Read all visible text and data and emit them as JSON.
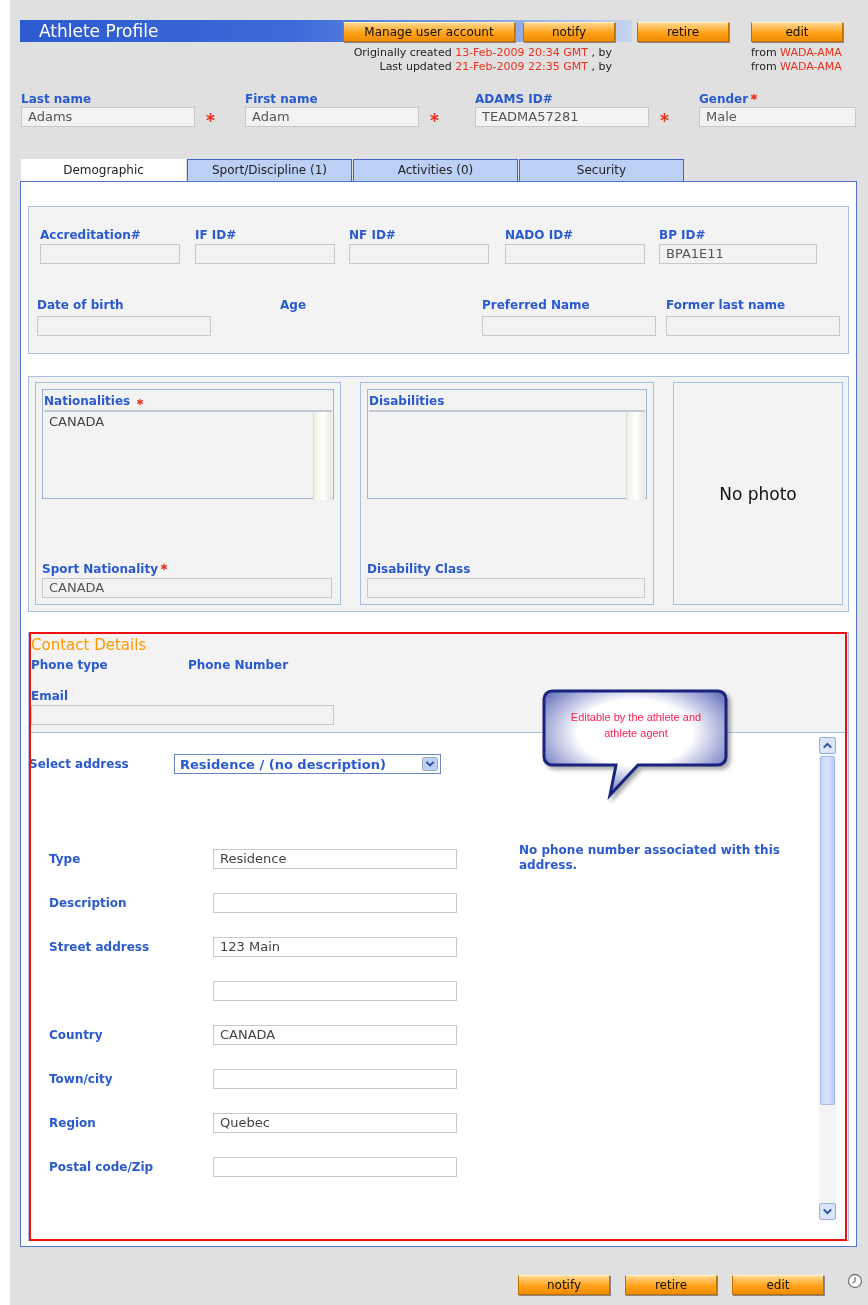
{
  "header": {
    "title": "Athlete Profile",
    "buttons": [
      "Manage user account",
      "notify",
      "retire",
      "edit"
    ]
  },
  "meta": [
    {
      "label": "Originally created",
      "date": "13-Feb-2009 20:34 GMT",
      "by": ", by",
      "from": "from",
      "org": "WADA-AMA"
    },
    {
      "label": "Last updated",
      "date": "21-Feb-2009 22:35 GMT",
      "by": ", by",
      "from": "from",
      "org": "WADA-AMA"
    }
  ],
  "identity": [
    {
      "label": "Last name",
      "value": "Adams",
      "required": true,
      "kind": "after_field"
    },
    {
      "label": "First name",
      "value": "Adam",
      "required": true,
      "kind": "after_field"
    },
    {
      "label": "ADAMS ID#",
      "value": "TEADMA57281",
      "required": true,
      "kind": "after_field"
    },
    {
      "label": "Gender",
      "value": "Male",
      "required": true,
      "kind": "after_label"
    }
  ],
  "tabs": [
    {
      "label": "Demographic",
      "selected": true
    },
    {
      "label": "Sport/Discipline (1)",
      "selected": false
    },
    {
      "label": "Activities (0)",
      "selected": false
    },
    {
      "label": "Security",
      "selected": false
    }
  ],
  "ids_row": [
    {
      "label": "Accreditation#",
      "kind": "input"
    },
    {
      "label": "IF ID#",
      "kind": "input"
    },
    {
      "label": "NF ID#",
      "kind": "input"
    },
    {
      "label": "NADO ID#",
      "kind": "input"
    },
    {
      "label": "BP ID#",
      "kind": "input",
      "value": "BPA1E11"
    }
  ],
  "personal_row": [
    {
      "label": "Date of birth",
      "kind": "input"
    },
    {
      "label": "Age",
      "kind": "text"
    },
    {
      "label": "Preferred Name",
      "kind": "input"
    },
    {
      "label": "Former last name",
      "kind": "input"
    }
  ],
  "nationalities": {
    "label": "Nationalities",
    "required": true,
    "items": [
      "CANADA"
    ]
  },
  "disabilities": {
    "label": "Disabilities"
  },
  "sport_nationality": {
    "label": "Sport Nationality",
    "value": "CANADA",
    "required": true
  },
  "disability_class": {
    "label": "Disability Class"
  },
  "photo": "No photo",
  "contact": {
    "title": "Contact Details",
    "phone_headers": [
      "Phone type",
      "Phone Number"
    ],
    "email_label": "Email"
  },
  "callout": "Editable by the athlete and athlete agent",
  "address": {
    "select_label": "Select address",
    "select_value": "Residence / (no description)",
    "fields": [
      {
        "kind": "field",
        "label": "Type",
        "value": "Residence"
      },
      {
        "kind": "field",
        "label": "Description"
      },
      {
        "kind": "field",
        "label": "Street address",
        "value": "123 Main"
      },
      {
        "kind": "continuation"
      },
      {
        "kind": "field",
        "label": "Country",
        "value": "CANADA"
      },
      {
        "kind": "field",
        "label": "Town/city"
      },
      {
        "kind": "field",
        "label": "Region",
        "value": "Quebec"
      },
      {
        "kind": "field",
        "label": "Postal code/Zip"
      }
    ],
    "note": "No phone number associated with this address."
  },
  "footer_buttons": [
    "notify",
    "retire",
    "edit"
  ]
}
